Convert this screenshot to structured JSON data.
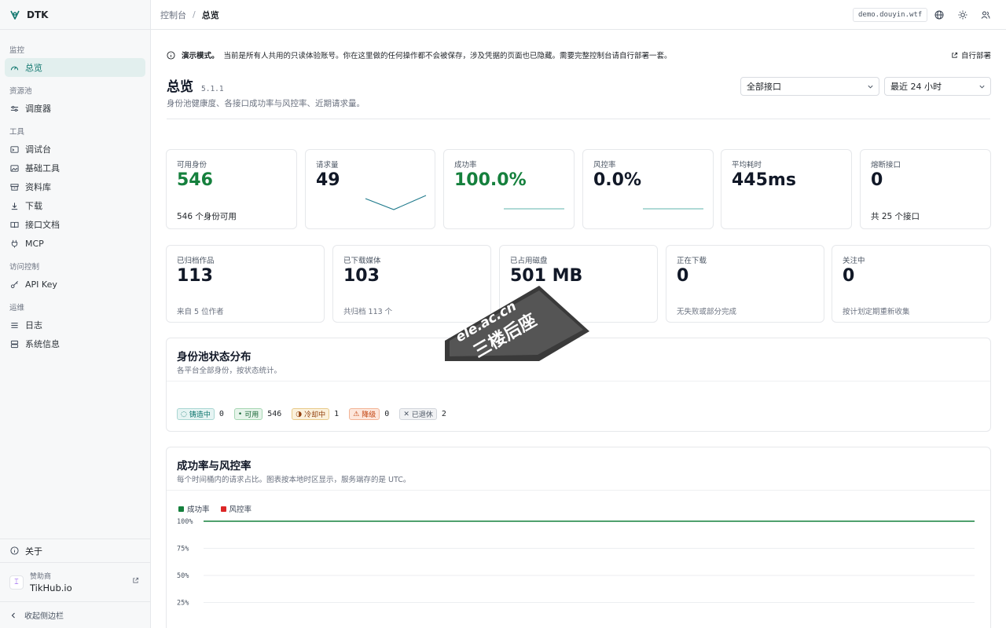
{
  "app": {
    "name": "DTK"
  },
  "sidebar": {
    "groups": [
      {
        "label": "监控",
        "items": [
          {
            "label": "总览",
            "icon": "gauge-icon",
            "active": true
          }
        ]
      },
      {
        "label": "资源池",
        "items": [
          {
            "label": "调度器",
            "icon": "sliders-icon"
          }
        ]
      },
      {
        "label": "工具",
        "items": [
          {
            "label": "调试台",
            "icon": "terminal-icon"
          },
          {
            "label": "基础工具",
            "icon": "image-icon"
          },
          {
            "label": "资料库",
            "icon": "archive-icon"
          },
          {
            "label": "下载",
            "icon": "download-icon"
          },
          {
            "label": "接口文档",
            "icon": "book-icon"
          },
          {
            "label": "MCP",
            "icon": "plug-icon"
          }
        ]
      },
      {
        "label": "访问控制",
        "items": [
          {
            "label": "API Key",
            "icon": "key-icon"
          }
        ]
      },
      {
        "label": "运维",
        "items": [
          {
            "label": "日志",
            "icon": "list-icon"
          },
          {
            "label": "系统信息",
            "icon": "server-icon"
          }
        ]
      }
    ],
    "about": "关于",
    "sponsor": {
      "label": "赞助商",
      "name": "TikHub.io"
    },
    "collapse": "收起侧边栏"
  },
  "topbar": {
    "breadcrumb": [
      "控制台",
      "总览"
    ],
    "host": "demo.douyin.wtf"
  },
  "notice": {
    "title": "演示模式。",
    "text": "当前是所有人共用的只读体验账号。你在这里做的任何操作都不会被保存，涉及凭据的页面也已隐藏。需要完整控制台请自行部署一套。",
    "link": "自行部署"
  },
  "header": {
    "title": "总览",
    "version": "5.1.1",
    "subtitle": "身份池健康度、各接口成功率与风控率、近期请求量。",
    "filter_endpoint": "全部接口",
    "filter_range": "最近 24 小时"
  },
  "stats_row1": [
    {
      "label": "可用身份",
      "value": "546",
      "foot": "546 个身份可用"
    },
    {
      "label": "请求量",
      "value": "49"
    },
    {
      "label": "成功率",
      "value": "100.0%"
    },
    {
      "label": "风控率",
      "value": "0.0%"
    },
    {
      "label": "平均耗时",
      "value": "445ms"
    },
    {
      "label": "熔断接口",
      "value": "0",
      "foot": "共 25 个接口"
    }
  ],
  "stats_row2": [
    {
      "label": "已归档作品",
      "value": "113",
      "foot": "来自 5 位作者"
    },
    {
      "label": "已下载媒体",
      "value": "103",
      "foot": "共归档 113 个"
    },
    {
      "label": "已占用磁盘",
      "value": "501 MB",
      "foot": ""
    },
    {
      "label": "正在下载",
      "value": "0",
      "foot": "无失败或部分完成"
    },
    {
      "label": "关注中",
      "value": "0",
      "foot": "按计划定期重新收集"
    }
  ],
  "identity_pool": {
    "title": "身份池状态分布",
    "subtitle": "各平台全部身份，按状态统计。",
    "statuses": [
      {
        "label": "铸造中",
        "count": "0",
        "icon": "spinner-icon"
      },
      {
        "label": "可用",
        "count": "546",
        "icon": "dot-icon"
      },
      {
        "label": "冷却中",
        "count": "1",
        "icon": "half-moon-icon"
      },
      {
        "label": "降级",
        "count": "0",
        "icon": "warning-icon"
      },
      {
        "label": "已退休",
        "count": "2",
        "icon": "x-icon"
      }
    ]
  },
  "rates_chart": {
    "title": "成功率与风控率",
    "subtitle": "每个时间桶内的请求占比。图表按本地时区显示，服务端存的是 UTC。",
    "legend": [
      "成功率",
      "风控率"
    ],
    "colors": {
      "success": "#15803d",
      "risk": "#dc2626"
    }
  },
  "chart_data": {
    "type": "line",
    "series": [
      {
        "name": "成功率",
        "values": [
          100,
          100
        ]
      },
      {
        "name": "风控率",
        "values": []
      }
    ],
    "yticks": [
      "100%",
      "75%",
      "50%",
      "25%"
    ],
    "ylim": [
      0,
      100
    ]
  },
  "watermark": {
    "line1": "ele.ac.cn",
    "line2": "三楼后座"
  }
}
